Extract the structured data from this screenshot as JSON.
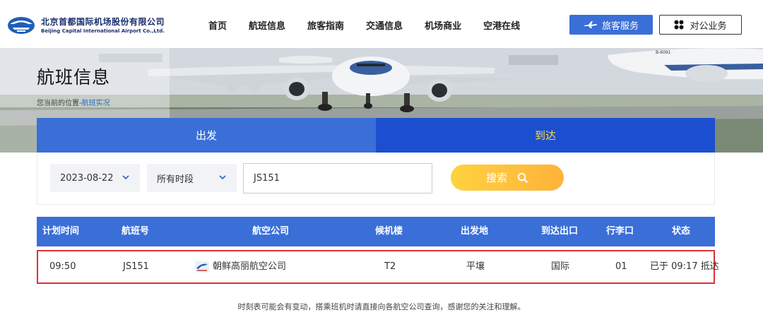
{
  "header": {
    "logo_cn": "北京首都国际机场股份有限公司",
    "logo_en": "Beijing Capital International Airport Co.,Ltd.",
    "nav": [
      "首页",
      "航班信息",
      "旅客指南",
      "交通信息",
      "机场商业",
      "空港在线"
    ],
    "service_button": "旅客服务",
    "corp_button": "对公业务"
  },
  "banner": {
    "title": "航班信息",
    "breadcrumb_prefix": "您当前的位置",
    "breadcrumb_sep": "-",
    "breadcrumb_current": "航班实况",
    "aircraft_reg": "B-6091"
  },
  "tabs": {
    "depart": "出发",
    "arrive": "到达"
  },
  "search": {
    "date": "2023-08-22",
    "period": "所有时段",
    "flight_no": "JS151",
    "button": "搜索"
  },
  "table": {
    "headers": [
      "计划时间",
      "航班号",
      "航空公司",
      "候机楼",
      "出发地",
      "到达出口",
      "行李口",
      "状态"
    ],
    "row": {
      "time": "09:50",
      "flight": "JS151",
      "airline": "朝鲜高丽航空公司",
      "terminal": "T2",
      "origin": "平壤",
      "exit": "国际",
      "baggage": "01",
      "status": "已于 09:17 抵达"
    }
  },
  "note": "时刻表可能会有变动，搭乘班机时请直接向各航空公司查询，感谢您的关注和理解。",
  "colors": {
    "primary_blue": "#3a6fd8",
    "arrive_tab_blue": "#1b4fcf",
    "arrive_tab_text": "#ffd93b",
    "search_gradient_start": "#ffd23f",
    "search_gradient_end": "#ffb23a",
    "highlight_red": "#e0303a"
  }
}
